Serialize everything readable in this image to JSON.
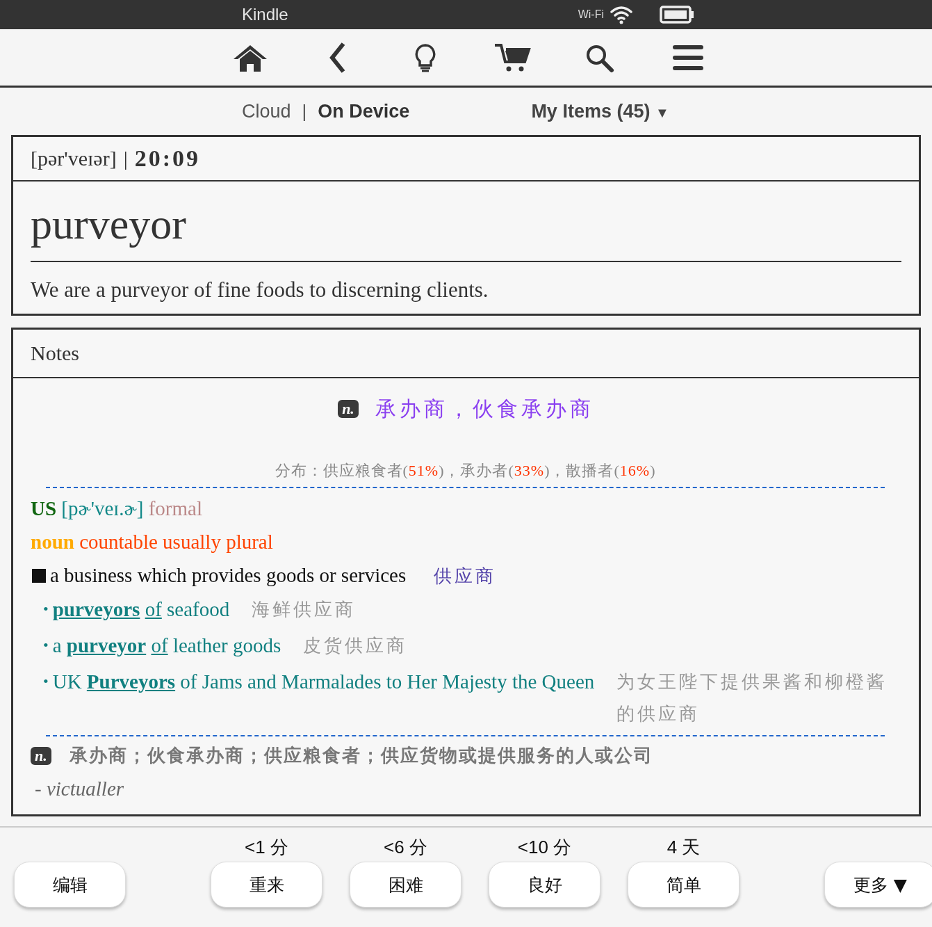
{
  "status_bar": {
    "app": "Kindle",
    "wifi_label": "Wi-Fi"
  },
  "library_tabs": [
    {
      "label": "Cloud",
      "selected": false
    },
    {
      "label": "On Device",
      "selected": true
    }
  ],
  "tab_separator": "|",
  "items_filter": {
    "label": "My Items (45)",
    "caret": "▼"
  },
  "word_card": {
    "pronunciation": "[pər'veɪər]",
    "separator": "|",
    "time": "20:09",
    "word": "purveyor",
    "example": "We are a purveyor of fine foods to discerning clients."
  },
  "notes": {
    "title": "Notes",
    "pos": "n.",
    "translation": "承办商，伙食承办商",
    "distribution": [
      {
        "kind": "label",
        "text": "分布：供应粮食者("
      },
      {
        "kind": "percent",
        "text": "51%"
      },
      {
        "kind": "label",
        "text": ")，承办者("
      },
      {
        "kind": "percent",
        "text": "33%"
      },
      {
        "kind": "label",
        "text": ")，散播者("
      },
      {
        "kind": "percent",
        "text": "16%"
      },
      {
        "kind": "label",
        "text": ")"
      }
    ],
    "region": "US",
    "ipa": "[pɚ'veɪ.ɚ]",
    "register": "formal",
    "word_class": "noun",
    "grammar": "countable usually plural",
    "definition": "a business which provides goods or services",
    "definition_zh": "供应商",
    "examples": [
      {
        "bullet": "•",
        "segments": [
          {
            "kind": "headword",
            "text": "purveyors"
          },
          {
            "kind": "link",
            "text": "of"
          },
          {
            "kind": "plain",
            "text": " seafood"
          }
        ],
        "zh": "海鲜供应商"
      },
      {
        "bullet": "•",
        "segments": [
          {
            "kind": "plain",
            "text": "a "
          },
          {
            "kind": "headword",
            "text": "purveyor"
          },
          {
            "kind": "link",
            "text": "of"
          },
          {
            "kind": "plain",
            "text": " leather goods"
          }
        ],
        "zh": "皮货供应商"
      },
      {
        "bullet": "•",
        "segments": [
          {
            "kind": "plain",
            "text": "UK "
          },
          {
            "kind": "headword",
            "text": "Purveyors"
          },
          {
            "kind": "plain",
            "text": " of Jams and Marmalades to Her Majesty the Queen"
          }
        ],
        "zh": "为女王陛下提供果酱和柳橙酱的供应商"
      }
    ],
    "summary_pos": "n.",
    "summary": "承办商；伙食承办商；供应粮食者；供应货物或提供服务的人或公司",
    "synonym": "- victualler"
  },
  "review_buttons": [
    {
      "label": "编辑"
    },
    {
      "interval": "<1 分",
      "label": "重来"
    },
    {
      "interval": "<6 分",
      "label": "困难"
    },
    {
      "interval": "<10 分",
      "label": "良好"
    },
    {
      "interval": "4 天",
      "label": "简单"
    },
    {
      "label": "更多",
      "caret": "▼"
    }
  ]
}
